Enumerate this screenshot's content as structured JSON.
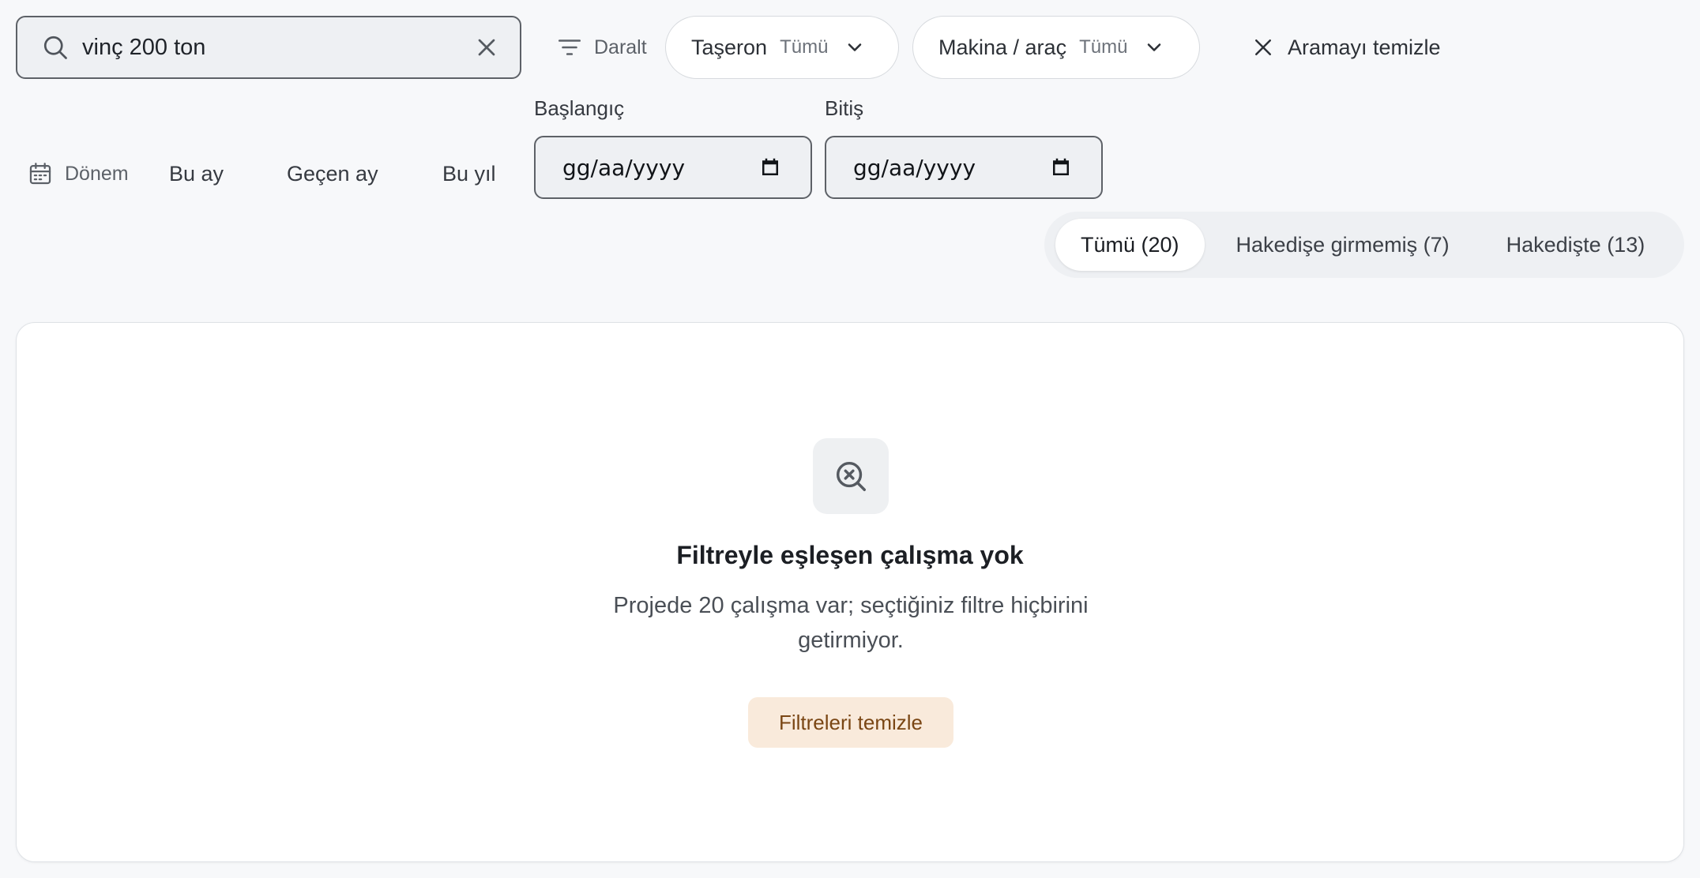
{
  "search": {
    "value": "vinç 200 ton",
    "icon": "search-icon",
    "clear_icon": "close-icon"
  },
  "filters": {
    "narrow_label": "Daralt",
    "taseron": {
      "label": "Taşeron",
      "value": "Tümü"
    },
    "makina": {
      "label": "Makina / araç",
      "value": "Tümü"
    },
    "clear_search_label": "Aramayı temizle"
  },
  "period": {
    "label": "Dönem",
    "quick": [
      "Bu ay",
      "Geçen ay",
      "Bu yıl"
    ],
    "start_label": "Başlangıç",
    "end_label": "Bitiş",
    "date_placeholder": "gg/aa/yyyy"
  },
  "tabs": [
    {
      "label": "Tümü (20)",
      "active": true
    },
    {
      "label": "Hakedişe girmemiş (7)",
      "active": false
    },
    {
      "label": "Hakedişte (13)",
      "active": false
    }
  ],
  "empty_state": {
    "title": "Filtreyle eşleşen çalışma yok",
    "description": "Projede 20 çalışma var; seçtiğiniz filtre hiçbirini getirmiyor.",
    "button_label": "Filtreleri temizle",
    "icon": "search-off-icon"
  },
  "colors": {
    "page_bg": "#f7f8fa",
    "accent_button_bg": "#f9eadb",
    "accent_button_text": "#7a4614"
  }
}
